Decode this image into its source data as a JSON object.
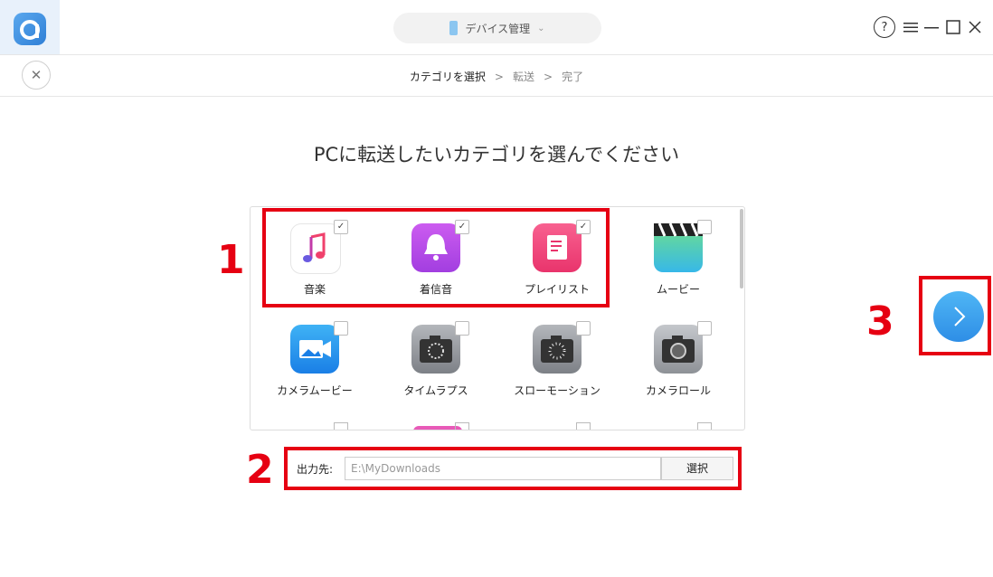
{
  "header": {
    "device_label": "デバイス管理"
  },
  "steps": [
    "カテゴリを選択",
    "転送",
    "完了"
  ],
  "step_sep": ">",
  "page_title": "PCに転送したいカテゴリを選んでください",
  "categories": [
    {
      "label": "音楽",
      "checked": true,
      "icon": "music-icon",
      "color": "#ffffff"
    },
    {
      "label": "着信音",
      "checked": true,
      "icon": "bell-icon",
      "color": "#b44ae8"
    },
    {
      "label": "プレイリスト",
      "checked": true,
      "icon": "playlist-icon",
      "color": "#f1487d"
    },
    {
      "label": "ムービー",
      "checked": false,
      "icon": "clapperboard-icon",
      "color": "#4cc3f0"
    },
    {
      "label": "カメラムービー",
      "checked": false,
      "icon": "camera-movie-icon",
      "color": "#2a9bf0"
    },
    {
      "label": "タイムラプス",
      "checked": false,
      "icon": "timelapse-icon",
      "color": "#8f9398"
    },
    {
      "label": "スローモーション",
      "checked": false,
      "icon": "slow-motion-icon",
      "color": "#8f9398"
    },
    {
      "label": "カメラロール",
      "checked": false,
      "icon": "camera-icon",
      "color": "#9a9ea3"
    }
  ],
  "output": {
    "label": "出力先:",
    "path": "E:\\MyDownloads",
    "button": "選択"
  },
  "annotations": [
    "1",
    "2",
    "3"
  ],
  "colors": {
    "accent": "#2e8ee6",
    "highlight": "#e60012"
  }
}
